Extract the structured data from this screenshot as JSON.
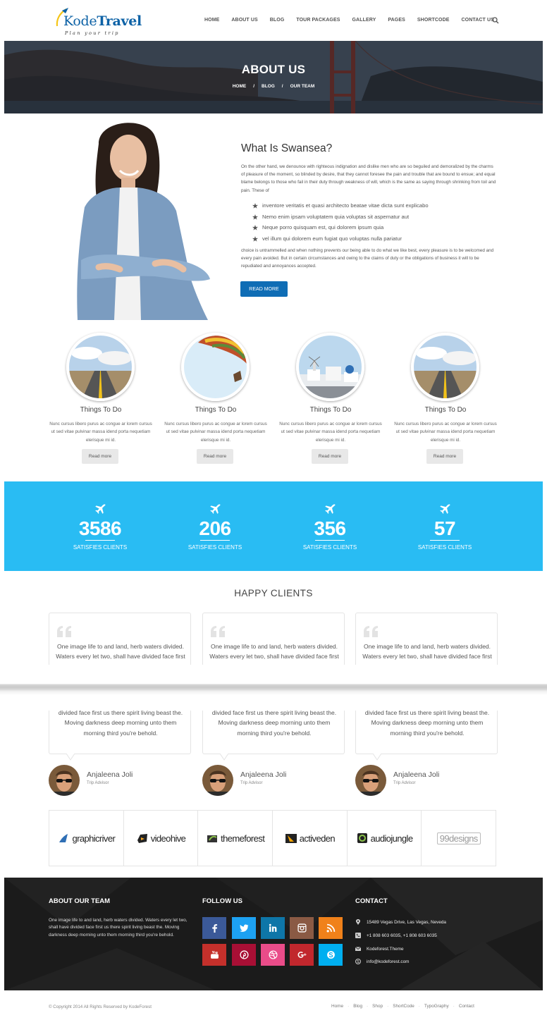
{
  "header": {
    "logo_kode": "Kode",
    "logo_travel": "Travel",
    "logo_tagline": "Plan your trip",
    "nav": [
      "HOME",
      "ABOUT US",
      "BLOG",
      "TOUR PACKAGES",
      "GALLERY",
      "PAGES",
      "SHORTCODE",
      "CONTACT US"
    ],
    "search_icon": "search-icon"
  },
  "banner": {
    "title": "ABOUT US",
    "crumbs": [
      "HOME",
      "/",
      "BLOG",
      "/",
      "OUR TEAM"
    ]
  },
  "about": {
    "title": "What Is Swansea?",
    "p1": "On the other hand, we denounce with righteous indignation and dislike men who are so beguiled and demoralized by the charms of pleasure of the moment, so blinded by desire, that they cannot foresee the pain and trouble that are bound to ensue; and equal blame belongs to those who fail in their duty through weakness of will, which is the same as saying through shrinking from toil and pain. These of",
    "bullets": [
      "inventore veritatis et quasi architecto beatae vitae dicta sunt explicabo",
      "Nemo enim ipsam voluptatem quia voluptas sit aspernatur aut",
      "Neque porro quisquam est, qui dolorem ipsum quia",
      "vel illum qui dolorem eum fugiat quo voluptas nulla pariatur"
    ],
    "p2": "choice is untrammelled and when nothing prevents our being able to do what we like best, every pleasure is to be welcomed and every pain avoided. But in certain circumstances and owing to the claims of duty or the obligations of business it will to be repudiated and annoyances accepted.",
    "button": "READ MORE"
  },
  "things": [
    {
      "title": "Things To Do",
      "desc": "Nunc cursus libero purus ac congue ar lorem cursus ut sed vitae pulvinar massa idend porta nequetiam elerisque mi id.",
      "button": "Read more",
      "image": "road"
    },
    {
      "title": "Things To Do",
      "desc": "Nunc cursus libero purus ac congue ar lorem cursus ut sed vitae pulvinar massa idend porta nequetiam elerisque mi id.",
      "button": "Read more",
      "image": "balloon"
    },
    {
      "title": "Things To Do",
      "desc": "Nunc cursus libero purus ac congue ar lorem cursus ut sed vitae pulvinar massa idend porta nequetiam elerisque mi id.",
      "button": "Read more",
      "image": "santorini"
    },
    {
      "title": "Things To Do",
      "desc": "Nunc cursus libero purus ac congue ar lorem cursus ut sed vitae pulvinar massa idend porta nequetiam elerisque mi id.",
      "button": "Read more",
      "image": "road"
    }
  ],
  "stats": [
    {
      "value": "3586",
      "label": "SATISFIES CLIENTS"
    },
    {
      "value": "206",
      "label": "SATISFIES CLIENTS"
    },
    {
      "value": "356",
      "label": "SATISFIES CLIENTS"
    },
    {
      "value": "57",
      "label": "SATISFIES CLIENTS"
    }
  ],
  "clients": {
    "title": "HAPPY CLIENTS",
    "top_text": "One image life to and land, herb waters divided. Waters every let two, shall have divided face first us there spirit living beast",
    "bottom_text": "divided face first us there spirit living beast the. Moving darkness deep morning unto them morning third you're behold.",
    "people": [
      {
        "name": "Anjaleena Joli",
        "role": "Trip Advisor"
      },
      {
        "name": "Anjaleena Joli",
        "role": "Trip Advisor"
      },
      {
        "name": "Anjaleena Joli",
        "role": "Trip Advisor"
      }
    ]
  },
  "brands": [
    "graphicriver",
    "videohive",
    "themeforest",
    "activeden",
    "audiojungle",
    "99designs"
  ],
  "footer": {
    "about_title": "ABOUT OUR TEAM",
    "about_text": "One image life to and land, herb waters divided. Waters every let two, shall have divided face first us there spirit living beast the. Moving darkness deep morning unto them morning third you're behold.",
    "follow_title": "FOLLOW US",
    "social": [
      {
        "name": "facebook",
        "color": "#3b5998"
      },
      {
        "name": "twitter",
        "color": "#1da1f2"
      },
      {
        "name": "linkedin",
        "color": "#0e76a8"
      },
      {
        "name": "instagram",
        "color": "#8a5a44"
      },
      {
        "name": "rss",
        "color": "#f0811a"
      },
      {
        "name": "youtube",
        "color": "#c4302b"
      },
      {
        "name": "pinterest",
        "color": "#a80f35"
      },
      {
        "name": "dribbble",
        "color": "#ea4c89"
      },
      {
        "name": "google-plus",
        "color": "#c1272d"
      },
      {
        "name": "skype",
        "color": "#00aff0"
      }
    ],
    "contact_title": "CONTACT",
    "contact": [
      {
        "icon": "map-pin-icon",
        "text": "15489 Vegas Drive, Las Vegas, Neveda"
      },
      {
        "icon": "phone-icon",
        "text": "+1 808 603 6035, +1 808 603 6035"
      },
      {
        "icon": "mail-icon",
        "text": "Kodeforest.Theme"
      },
      {
        "icon": "skype-icon",
        "text": "info@kodeforest.com"
      }
    ]
  },
  "bottom": {
    "copyright": "© Copyright 2014 All Rights Reserved by KodeForest",
    "links": [
      "Home",
      "Blog",
      "Shop",
      "ShortCode",
      "TypoGraphy",
      "Contact"
    ]
  },
  "colors": {
    "brand_blue": "#0f6db5",
    "stats_bg": "#29bcf3",
    "footer_bg": "#1b1b1b"
  }
}
